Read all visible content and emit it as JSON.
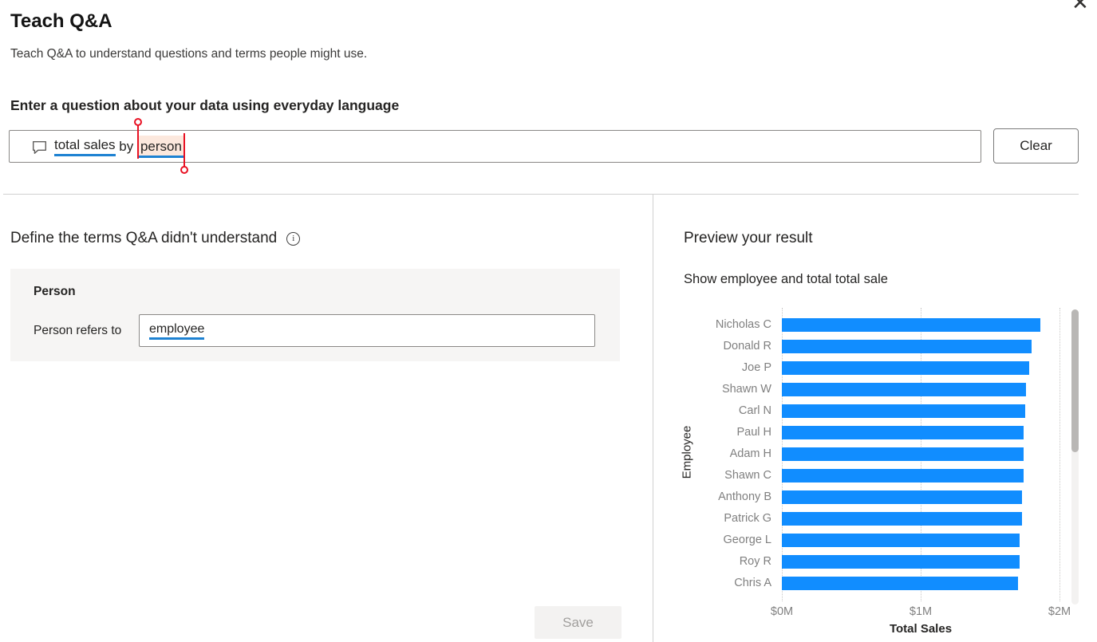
{
  "dialog": {
    "title": "Teach Q&A",
    "subtitle": "Teach Q&A to understand questions and terms people might use.",
    "close_icon": "✕"
  },
  "question": {
    "label": "Enter a question about your data using everyday language",
    "tokens": {
      "recognized": "total sales",
      "connector": " by ",
      "selected": "person"
    },
    "clear_label": "Clear"
  },
  "definitions": {
    "heading": "Define the terms Q&A didn't understand",
    "info_icon": "i",
    "term": {
      "name": "Person",
      "refers_label": "Person refers to",
      "value": "employee"
    },
    "save_label": "Save"
  },
  "preview": {
    "heading": "Preview your result",
    "question_text": "Show employee and total total sale"
  },
  "chart_data": {
    "type": "bar",
    "orientation": "horizontal",
    "title": "",
    "categories": [
      "Nicholas C",
      "Donald R",
      "Joe P",
      "Shawn W",
      "Carl N",
      "Paul H",
      "Adam H",
      "Shawn C",
      "Anthony B",
      "Patrick G",
      "George L",
      "Roy R",
      "Chris A"
    ],
    "values": [
      1.86,
      1.8,
      1.78,
      1.76,
      1.75,
      1.74,
      1.74,
      1.74,
      1.73,
      1.73,
      1.71,
      1.71,
      1.7
    ],
    "values_unit": "$M",
    "xlabel": "Total Sales",
    "ylabel": "Employee",
    "x_ticks": [
      "$0M",
      "$1M",
      "$2M"
    ],
    "x_tick_values": [
      0,
      1,
      2
    ],
    "xlim": [
      0,
      2.07
    ],
    "grid": "dotted-vertical",
    "legend": "none",
    "bar_color": "#118DFF",
    "scrollbar": true
  },
  "colors": {
    "accent_blue": "#118DFF",
    "underline_blue": "#1e82d2",
    "selection_red": "#e81123",
    "selection_highlight": "#fce8dd",
    "card_background": "#f6f5f4",
    "divider": "#d1d1d1",
    "muted_text": "#808080"
  }
}
